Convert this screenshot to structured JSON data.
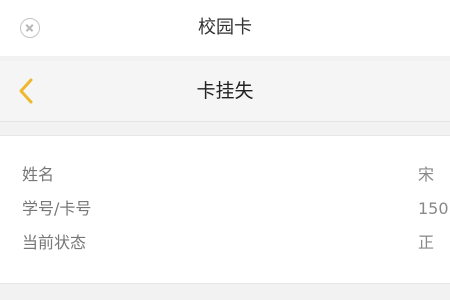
{
  "window": {
    "title": "校园卡",
    "close_icon": "close-circle-icon"
  },
  "navbar": {
    "back_icon": "chevron-left-icon",
    "accent_color": "#f0b62e",
    "title": "卡挂失"
  },
  "info": {
    "rows": [
      {
        "label": "姓名",
        "value": "宋"
      },
      {
        "label": "学号/卡号",
        "value": "150"
      },
      {
        "label": "当前状态",
        "value": "正"
      }
    ]
  }
}
